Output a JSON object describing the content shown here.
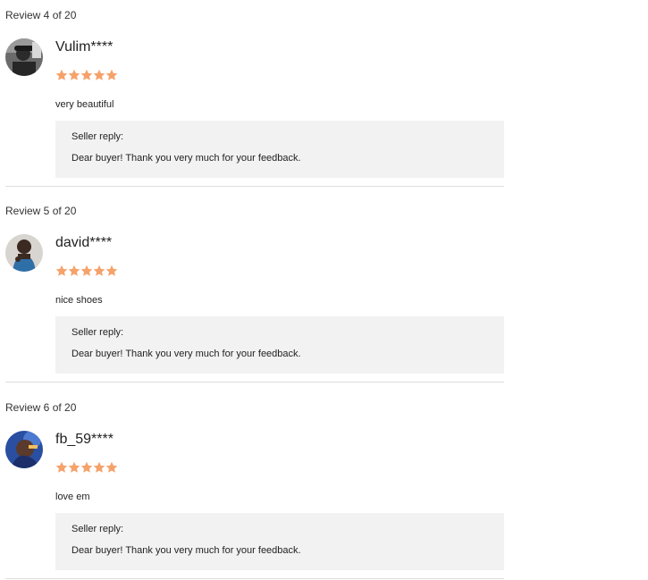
{
  "reviews": [
    {
      "counter": "Review 4 of 20",
      "username": "Vulim****",
      "rating": 5,
      "text": "very beautiful",
      "reply_label": "Seller reply:",
      "reply_text": "Dear buyer! Thank you very much for your feedback."
    },
    {
      "counter": "Review 5 of 20",
      "username": "david****",
      "rating": 5,
      "text": "nice shoes",
      "reply_label": "Seller reply:",
      "reply_text": "Dear buyer! Thank you very much for your feedback."
    },
    {
      "counter": "Review 6 of 20",
      "username": "fb_59****",
      "rating": 5,
      "text": "love em",
      "reply_label": "Seller reply:",
      "reply_text": "Dear buyer! Thank you very much for your feedback."
    }
  ],
  "colors": {
    "star": "#f5a26b",
    "reply_bg": "#f2f2f2",
    "divider": "#dddddd"
  },
  "icons": {
    "star": "star-icon"
  }
}
